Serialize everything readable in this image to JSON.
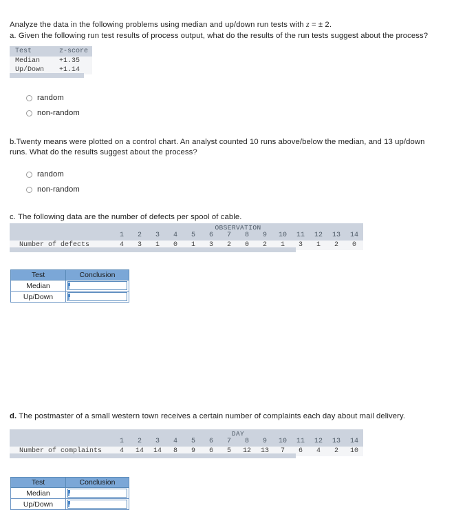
{
  "intro": {
    "text_before": "Analyze the data in the following problems using median and up/down run tests with ",
    "variable": "z",
    "text_after": " = ± 2."
  },
  "part_a": {
    "prompt": "a. Given the following run test results of process output, what do the results of the run tests suggest about the process?",
    "table": {
      "headers": [
        "Test",
        "z-score"
      ],
      "rows": [
        {
          "test": "Median",
          "zscore": "+1.35"
        },
        {
          "test": "Up/Down",
          "zscore": "+1.14"
        }
      ]
    },
    "options": [
      "random",
      "non-random"
    ]
  },
  "part_b": {
    "prompt": "b.Twenty means were plotted on a control chart. An analyst counted 10 runs above/below the median, and 13 up/down runs. What do the results suggest about the process?",
    "options": [
      "random",
      "non-random"
    ]
  },
  "part_c": {
    "prompt": "c. The following data are the number of defects per spool of cable.",
    "table": {
      "group_header": "OBSERVATION",
      "row_label": "Number of defects",
      "columns": [
        "1",
        "2",
        "3",
        "4",
        "5",
        "6",
        "7",
        "8",
        "9",
        "10",
        "11",
        "12",
        "13",
        "14"
      ],
      "values": [
        "4",
        "3",
        "1",
        "0",
        "1",
        "3",
        "2",
        "0",
        "2",
        "1",
        "3",
        "1",
        "2",
        "0"
      ]
    },
    "conclusion_table": {
      "headers": [
        "Test",
        "Conclusion"
      ],
      "rows": [
        {
          "test": "Median",
          "conclusion": ""
        },
        {
          "test": "Up/Down",
          "conclusion": ""
        }
      ]
    }
  },
  "part_d": {
    "prompt_bold": "d.",
    "prompt": " The postmaster of a small western town receives a certain number of complaints each day about mail delivery.",
    "table": {
      "group_header": "DAY",
      "row_label": "Number of complaints",
      "columns": [
        "1",
        "2",
        "3",
        "4",
        "5",
        "6",
        "7",
        "8",
        "9",
        "10",
        "11",
        "12",
        "13",
        "14"
      ],
      "values": [
        "4",
        "14",
        "14",
        "8",
        "9",
        "6",
        "5",
        "12",
        "13",
        "7",
        "6",
        "4",
        "2",
        "10"
      ]
    },
    "conclusion_table": {
      "headers": [
        "Test",
        "Conclusion"
      ],
      "rows": [
        {
          "test": "Median",
          "conclusion": ""
        },
        {
          "test": "Up/Down",
          "conclusion": ""
        }
      ]
    }
  },
  "colors": {
    "band": "#ccd3de",
    "band_alt": "#f4f5f7",
    "table_header_blue": "#7ba7d7",
    "input_border": "#5b8cbe"
  }
}
